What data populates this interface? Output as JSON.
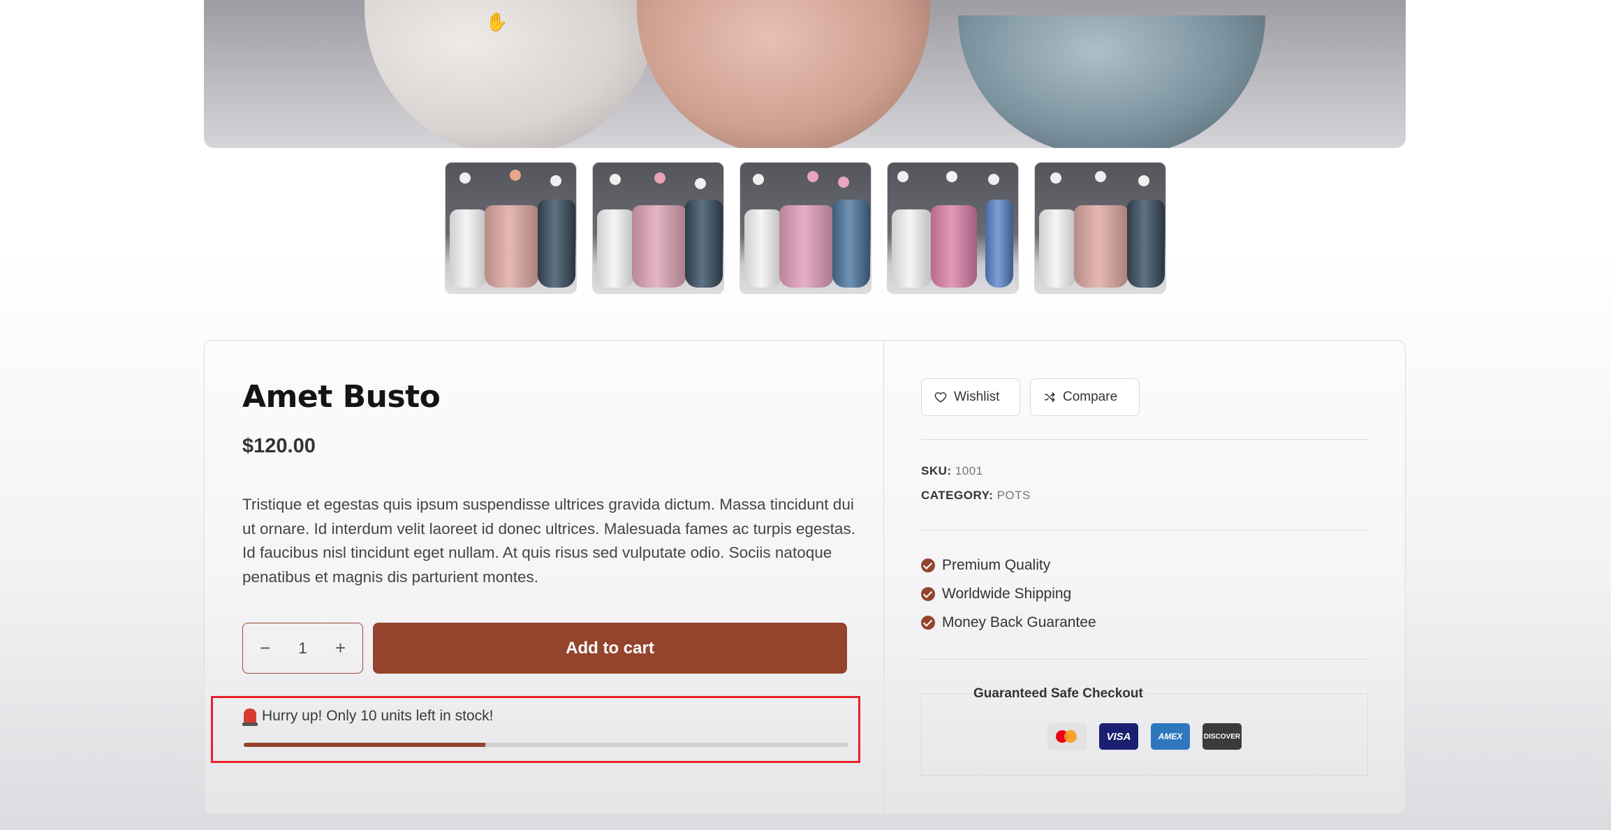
{
  "product": {
    "title": "Amet Busto",
    "price": "$120.00",
    "description": "Tristique et egestas quis ipsum suspendisse ultrices gravida dictum. Massa tincidunt dui ut ornare. Id interdum velit laoreet id donec ultrices. Malesuada fames ac turpis egestas. Id faucibus nisl tincidunt eget nullam. At quis risus sed vulputate odio. Sociis natoque penatibus et magnis dis parturient montes.",
    "quantity": "1",
    "add_to_cart_label": "Add to cart",
    "stock_message": "Hurry up! Only 10 units left in stock!",
    "stock_progress_fraction": 0.4
  },
  "actions": {
    "wishlist_label": "Wishlist",
    "compare_label": "Compare"
  },
  "meta": {
    "sku_label": "SKU:",
    "sku_value": "1001",
    "category_label": "CATEGORY:",
    "category_value": "POTS"
  },
  "features": [
    "Premium Quality",
    "Worldwide Shipping",
    "Money Back Guarantee"
  ],
  "checkout": {
    "title": "Guaranteed Safe Checkout",
    "payment_methods": [
      "mastercard-icon",
      "VISA",
      "AMEX",
      "DISCOVER"
    ]
  },
  "colors": {
    "accent": "#94442c",
    "highlight_border": "#e8212a"
  }
}
